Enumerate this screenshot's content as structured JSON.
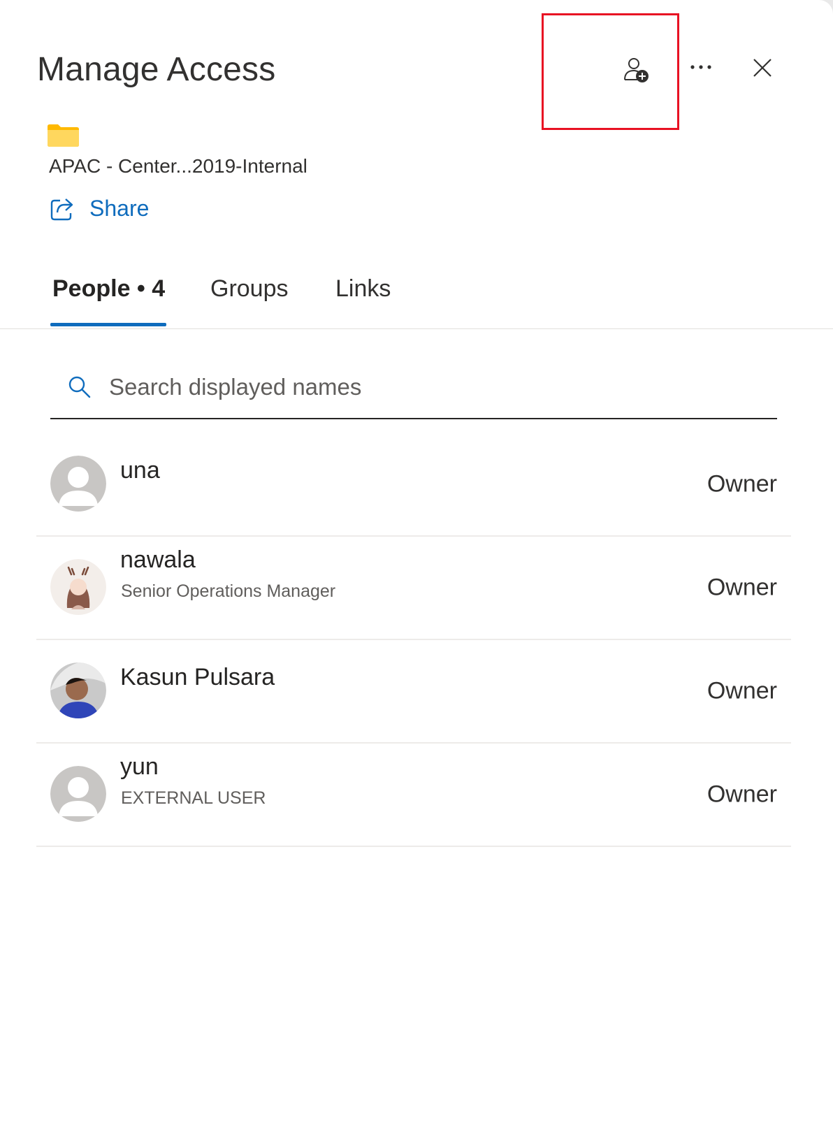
{
  "header": {
    "title": "Manage Access",
    "add_person_icon": "person-add-icon",
    "more_icon": "more-horizontal-icon",
    "close_icon": "close-icon"
  },
  "file": {
    "icon": "folder-icon",
    "name": "APAC - Center...2019-Internal"
  },
  "share": {
    "icon": "share-icon",
    "label": "Share"
  },
  "tabs": [
    {
      "label": "People • 4",
      "active": true
    },
    {
      "label": "Groups",
      "active": false
    },
    {
      "label": "Links",
      "active": false
    }
  ],
  "search": {
    "icon": "search-icon",
    "placeholder": "Search displayed names",
    "value": ""
  },
  "people": [
    {
      "name": "una",
      "subtitle": "",
      "role": "Owner",
      "avatar": "default-avatar"
    },
    {
      "name": "nawala",
      "subtitle": "Senior Operations Manager",
      "role": "Owner",
      "avatar": "photo-avatar"
    },
    {
      "name": "Kasun Pulsara",
      "subtitle": "",
      "role": "Owner",
      "avatar": "photo-avatar"
    },
    {
      "name": "yun",
      "subtitle": "EXTERNAL USER",
      "role": "Owner",
      "avatar": "default-avatar"
    }
  ],
  "colors": {
    "accent": "#0f6cbd",
    "highlight": "#e81123",
    "folder": "#ffc83d"
  }
}
